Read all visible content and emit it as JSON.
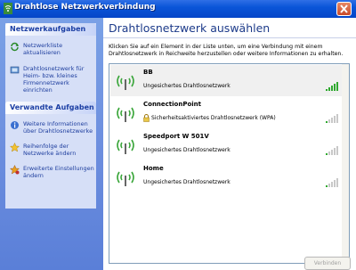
{
  "window": {
    "title": "Drahtlose Netzwerkverbindung"
  },
  "sidebar": {
    "panels": [
      {
        "title": "Netzwerkaufgaben",
        "tasks": [
          {
            "icon": "refresh-icon",
            "label": "Netzwerkliste aktualisieren"
          },
          {
            "icon": "network-setup-icon",
            "label": "Drahtlosnetzwerk für Heim- bzw. kleines Firmennetzwerk einrichten"
          }
        ]
      },
      {
        "title": "Verwandte Aufgaben",
        "tasks": [
          {
            "icon": "info-icon",
            "label": "Weitere Informationen über Drahtlosnetzwerke"
          },
          {
            "icon": "star-icon",
            "label": "Reihenfolge der Netzwerke ändern"
          },
          {
            "icon": "settings-icon",
            "label": "Erweiterte Einstellungen ändern"
          }
        ]
      }
    ]
  },
  "main": {
    "title": "Drahtlosnetzwerk auswählen",
    "description": "Klicken Sie auf ein Element in der Liste unten, um eine Verbindung mit einem Drahtlosnetzwerk in Reichweite herzustellen oder weitere Informationen zu erhalten.",
    "networks": [
      {
        "name": "BB",
        "security": "Ungesichertes Drahtlosnetzwerk",
        "secured": false,
        "signal_bars": 5,
        "selected": true
      },
      {
        "name": "ConnectionPoint",
        "security": "Sicherheitsaktiviertes Drahtlosnetzwerk (WPA)",
        "secured": true,
        "signal_bars": 1,
        "selected": false
      },
      {
        "name": "Speedport W 501V",
        "security": "Ungesichertes Drahtlosnetzwerk",
        "secured": false,
        "signal_bars": 1,
        "selected": false
      },
      {
        "name": "Home",
        "security": "Ungesichertes Drahtlosnetzwerk",
        "secured": false,
        "signal_bars": 1,
        "selected": false
      }
    ],
    "connect_button": "Verbinden"
  },
  "colors": {
    "signal_on": "#2fa82f",
    "signal_off": "#c8c8c8",
    "titlebar": "#0a55d8",
    "link": "#1e3e9e"
  }
}
